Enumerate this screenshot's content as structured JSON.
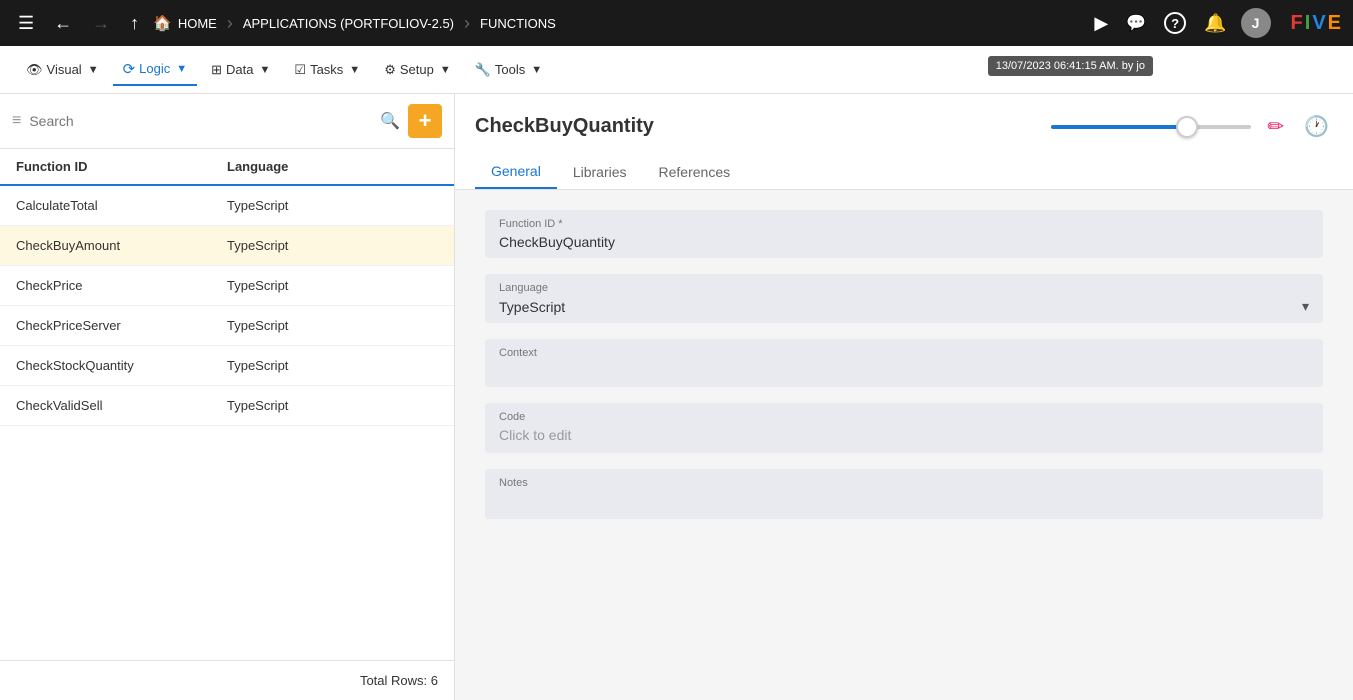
{
  "topnav": {
    "menu_icon": "☰",
    "back_icon": "←",
    "forward_icon": "→",
    "up_icon": "↑",
    "home_label": "HOME",
    "breadcrumb_sep1": "›",
    "breadcrumb_app": "APPLICATIONS (PORTFOLIOV-2.5)",
    "breadcrumb_sep2": "›",
    "breadcrumb_func": "FUNCTIONS",
    "play_icon": "▶",
    "search_icon": "🔍",
    "help_icon": "?",
    "bell_icon": "🔔",
    "avatar_letter": "J",
    "timestamp": "13/07/2023 06:41:15 AM. by jo"
  },
  "secondtoolbar": {
    "visual_label": "Visual",
    "logic_label": "Logic",
    "data_label": "Data",
    "tasks_label": "Tasks",
    "setup_label": "Setup",
    "tools_label": "Tools"
  },
  "sidebar": {
    "search_placeholder": "Search",
    "columns": {
      "function_id": "Function ID",
      "language": "Language"
    },
    "rows": [
      {
        "function_id": "CalculateTotal",
        "language": "TypeScript",
        "selected": false
      },
      {
        "function_id": "CheckBuyAmount",
        "language": "TypeScript",
        "selected": true
      },
      {
        "function_id": "CheckPrice",
        "language": "TypeScript",
        "selected": false
      },
      {
        "function_id": "CheckPriceServer",
        "language": "TypeScript",
        "selected": false
      },
      {
        "function_id": "CheckStockQuantity",
        "language": "TypeScript",
        "selected": false
      },
      {
        "function_id": "CheckValidSell",
        "language": "TypeScript",
        "selected": false
      }
    ],
    "total_rows_label": "Total Rows: 6"
  },
  "rightpanel": {
    "title": "CheckBuyQuantity",
    "tabs": [
      {
        "label": "General",
        "active": true
      },
      {
        "label": "Libraries",
        "active": false
      },
      {
        "label": "References",
        "active": false
      }
    ],
    "form": {
      "function_id_label": "Function ID *",
      "function_id_value": "CheckBuyQuantity",
      "language_label": "Language",
      "language_value": "TypeScript",
      "context_label": "Context",
      "context_value": "",
      "code_label": "Code",
      "code_placeholder": "Click to edit",
      "notes_label": "Notes",
      "notes_value": ""
    },
    "edit_icon": "✏",
    "history_icon": "🕐"
  }
}
